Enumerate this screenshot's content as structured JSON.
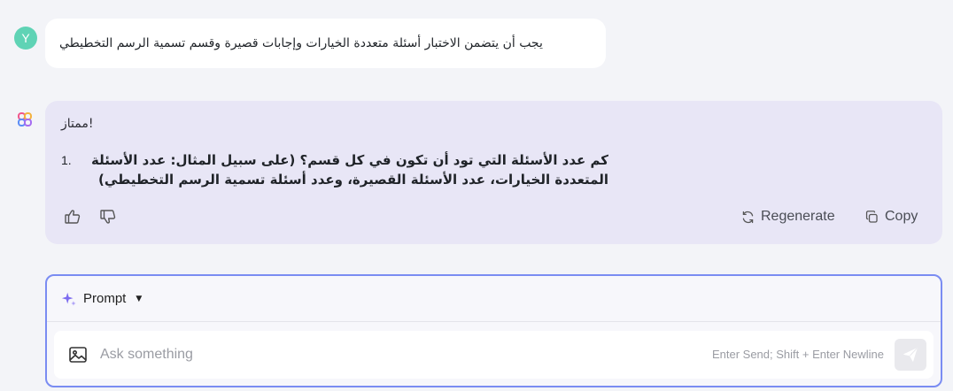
{
  "user_message": {
    "avatar_letter": "Y",
    "text": "يجب أن يتضمن الاختبار أسئلة متعددة الخيارات وإجابات قصيرة وقسم تسمية الرسم التخطيطي"
  },
  "bot_message": {
    "greeting": "ممتاز!",
    "list": [
      {
        "number": "1.",
        "text": "كم عدد الأسئلة التي تود أن تكون في كل قسم؟ (على سبيل المثال: عدد الأسئلة المتعددة الخيارات، عدد الأسئلة القصيرة، وعدد أسئلة تسمية الرسم التخطيطي)"
      }
    ],
    "actions": {
      "regenerate_label": "Regenerate",
      "copy_label": "Copy"
    }
  },
  "composer": {
    "mode_label": "Prompt",
    "placeholder": "Ask something",
    "hint": "Enter Send; Shift + Enter Newline"
  },
  "colors": {
    "accent": "#7a8cf2",
    "bot_bubble": "#e8e6f6",
    "user_avatar": "#5fd3b5"
  }
}
